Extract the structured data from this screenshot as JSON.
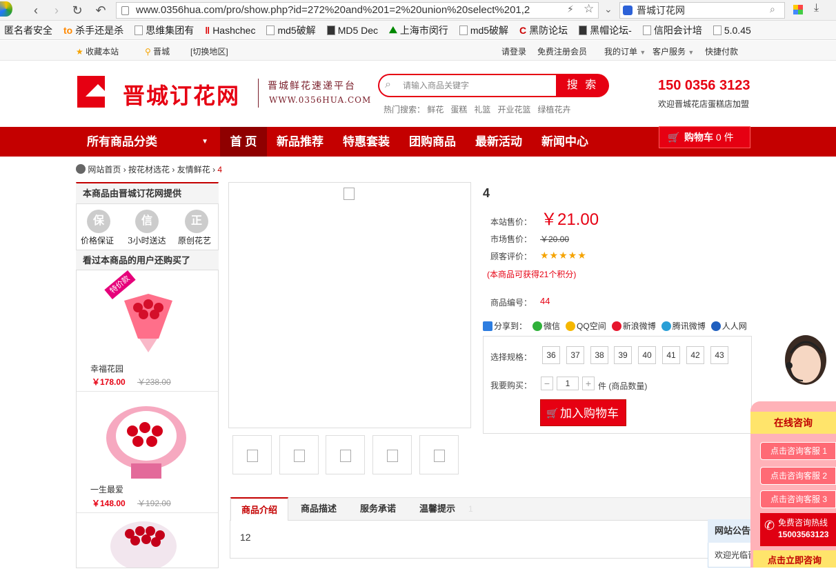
{
  "browser": {
    "url": "www.0356hua.com/pro/show.php?id=272%20and%201=2%20union%20select%201,2",
    "search_text": "晋城订花网",
    "bookmarks": [
      "匿名者安全",
      "杀手还是杀",
      "思维集团有",
      "Hashchec",
      "md5破解",
      "MD5 Dec",
      "上海市闵行",
      "md5破解",
      "黑防论坛",
      "黑帽论坛-",
      "信阳会计培",
      "5.0.45"
    ]
  },
  "topbar": {
    "favorite": "收藏本站",
    "city": "晋城",
    "switch_city": "[切换地区]",
    "login_prefix": "请",
    "login": "登录",
    "register_prefix": "免费",
    "register": "注册会员",
    "my_orders": "我的订单",
    "customer_service": "客户服务",
    "quick_pay": "快捷付款"
  },
  "header": {
    "logo_text": "晋城订花网",
    "slogan": "晋城鲜花速递平台",
    "slogan_url": "WWW.0356HUA.COM",
    "search_placeholder": "请输入商品关键字",
    "search_button": "搜 索",
    "hot_label": "热门搜索：",
    "hot_words": [
      "鲜花",
      "蛋糕",
      "礼篮",
      "开业花篮",
      "绿植花卉"
    ],
    "phone": "150 0356 3123",
    "welcome": "欢迎晋城花店蛋糕店加盟"
  },
  "nav": {
    "all_categories": "所有商品分类",
    "items": [
      "首 页",
      "新品推荐",
      "特惠套装",
      "团购商品",
      "最新活动",
      "新闻中心"
    ],
    "cart_label": "购物车",
    "cart_count": "0 件"
  },
  "breadcrumb": [
    "网站首页",
    "按花材选花",
    "友情鲜花",
    "4"
  ],
  "left": {
    "provider": "本商品由晋城订花网提供",
    "badges": [
      {
        "char": "保",
        "label": "价格保证"
      },
      {
        "char": "信",
        "label": "3小时送达"
      },
      {
        "char": "正",
        "label": "原创花艺"
      }
    ],
    "also_bought": "看过本商品的用户还购买了",
    "special_tag": "特价款",
    "products": [
      {
        "name": "幸福花园",
        "price": "￥178.00",
        "old": "￥238.00"
      },
      {
        "name": "一生最爱",
        "price": "￥148.00",
        "old": "￥192.00"
      }
    ]
  },
  "product": {
    "title": "4",
    "price_label": "本站售价：",
    "price": "￥21.00",
    "market_label": "市场售价：",
    "market_price": "￥20.00",
    "rating_label": "顾客评价：",
    "rating_stars": 5,
    "points_note": "(本商品可获得21个积分)",
    "sku_label": "商品编号：",
    "sku": "44",
    "share_label": "分享到：",
    "share_targets": [
      "微信",
      "QQ空间",
      "新浪微博",
      "腾讯微博",
      "人人网"
    ],
    "spec_label": "选择规格：",
    "sizes": [
      "36",
      "37",
      "38",
      "39",
      "40",
      "41",
      "42",
      "43"
    ],
    "qty_label": "我要购买：",
    "qty": "1",
    "qty_unit": "件 (商品数量)",
    "add_to_cart": "加入购物车"
  },
  "tabs": {
    "items": [
      "商品介绍",
      "商品描述",
      "服务承诺",
      "温馨提示"
    ],
    "extra": "1",
    "content": "12"
  },
  "consult": {
    "title": "在线咨询",
    "buttons": [
      "点击咨询客服 1",
      "点击咨询客服 2",
      "点击咨询客服 3"
    ],
    "hotline_label": "免费咨询热线",
    "hotline": "15003563123",
    "bottom": "点击立即咨询"
  },
  "notice": {
    "title": "网站公告",
    "text": "欢迎光临晋"
  },
  "colors": {
    "brand_red": "#e60012",
    "nav_red": "#c40000",
    "consult_yellow": "#ffe46b"
  }
}
